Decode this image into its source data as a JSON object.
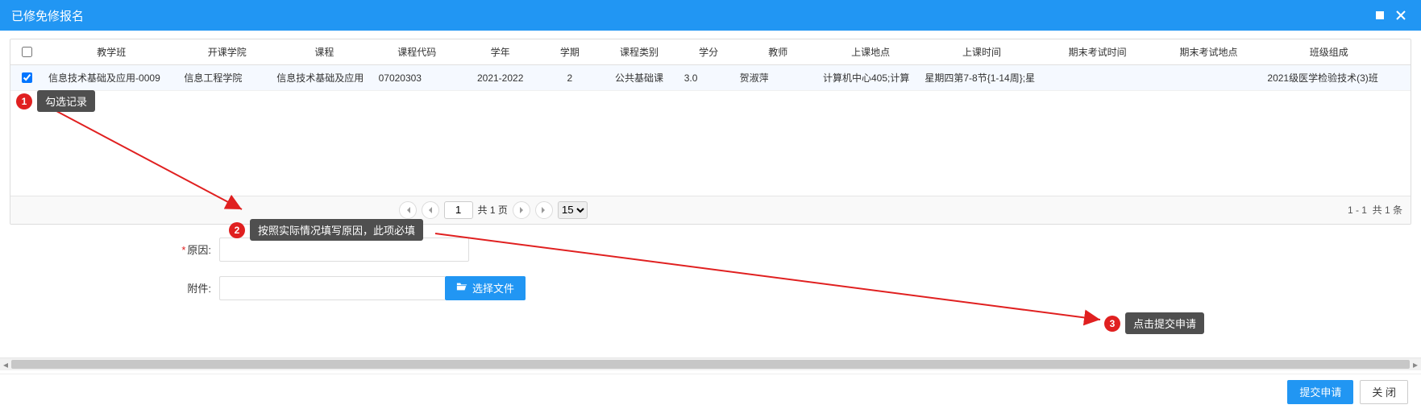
{
  "titlebar": {
    "title": "已修免修报名"
  },
  "table": {
    "headers": {
      "class": "教学班",
      "college": "开课学院",
      "course": "课程",
      "code": "课程代码",
      "year": "学年",
      "term": "学期",
      "type": "课程类别",
      "credit": "学分",
      "teacher": "教师",
      "loc": "上课地点",
      "time": "上课时间",
      "examTime": "期末考试时间",
      "examLoc": "期末考试地点",
      "group": "班级组成"
    },
    "row": {
      "class": "信息技术基础及应用-0009",
      "college": "信息工程学院",
      "course": "信息技术基础及应用",
      "code": "07020303",
      "year": "2021-2022",
      "term": "2",
      "type": "公共基础课",
      "credit": "3.0",
      "teacher": "贺淑萍",
      "loc": "计算机中心405;计算",
      "time": "星期四第7-8节{1-14周};星",
      "examTime": "",
      "examLoc": "",
      "group": "2021级医学检验技术(3)班"
    }
  },
  "paging": {
    "page_value": "1",
    "total_pages_label": "共 1 页",
    "page_size_selected": "15",
    "range_label": "1 - 1",
    "total_label": "共 1 条"
  },
  "form": {
    "reason_label": "原因:",
    "attach_label": "附件:",
    "file_btn": "选择文件"
  },
  "footer": {
    "submit": "提交申请",
    "close": "关 闭"
  },
  "annotations": {
    "a1": {
      "num": "1",
      "text": "勾选记录"
    },
    "a2": {
      "num": "2",
      "text": "按照实际情况填写原因，此项必填"
    },
    "a3": {
      "num": "3",
      "text": "点击提交申请"
    }
  }
}
